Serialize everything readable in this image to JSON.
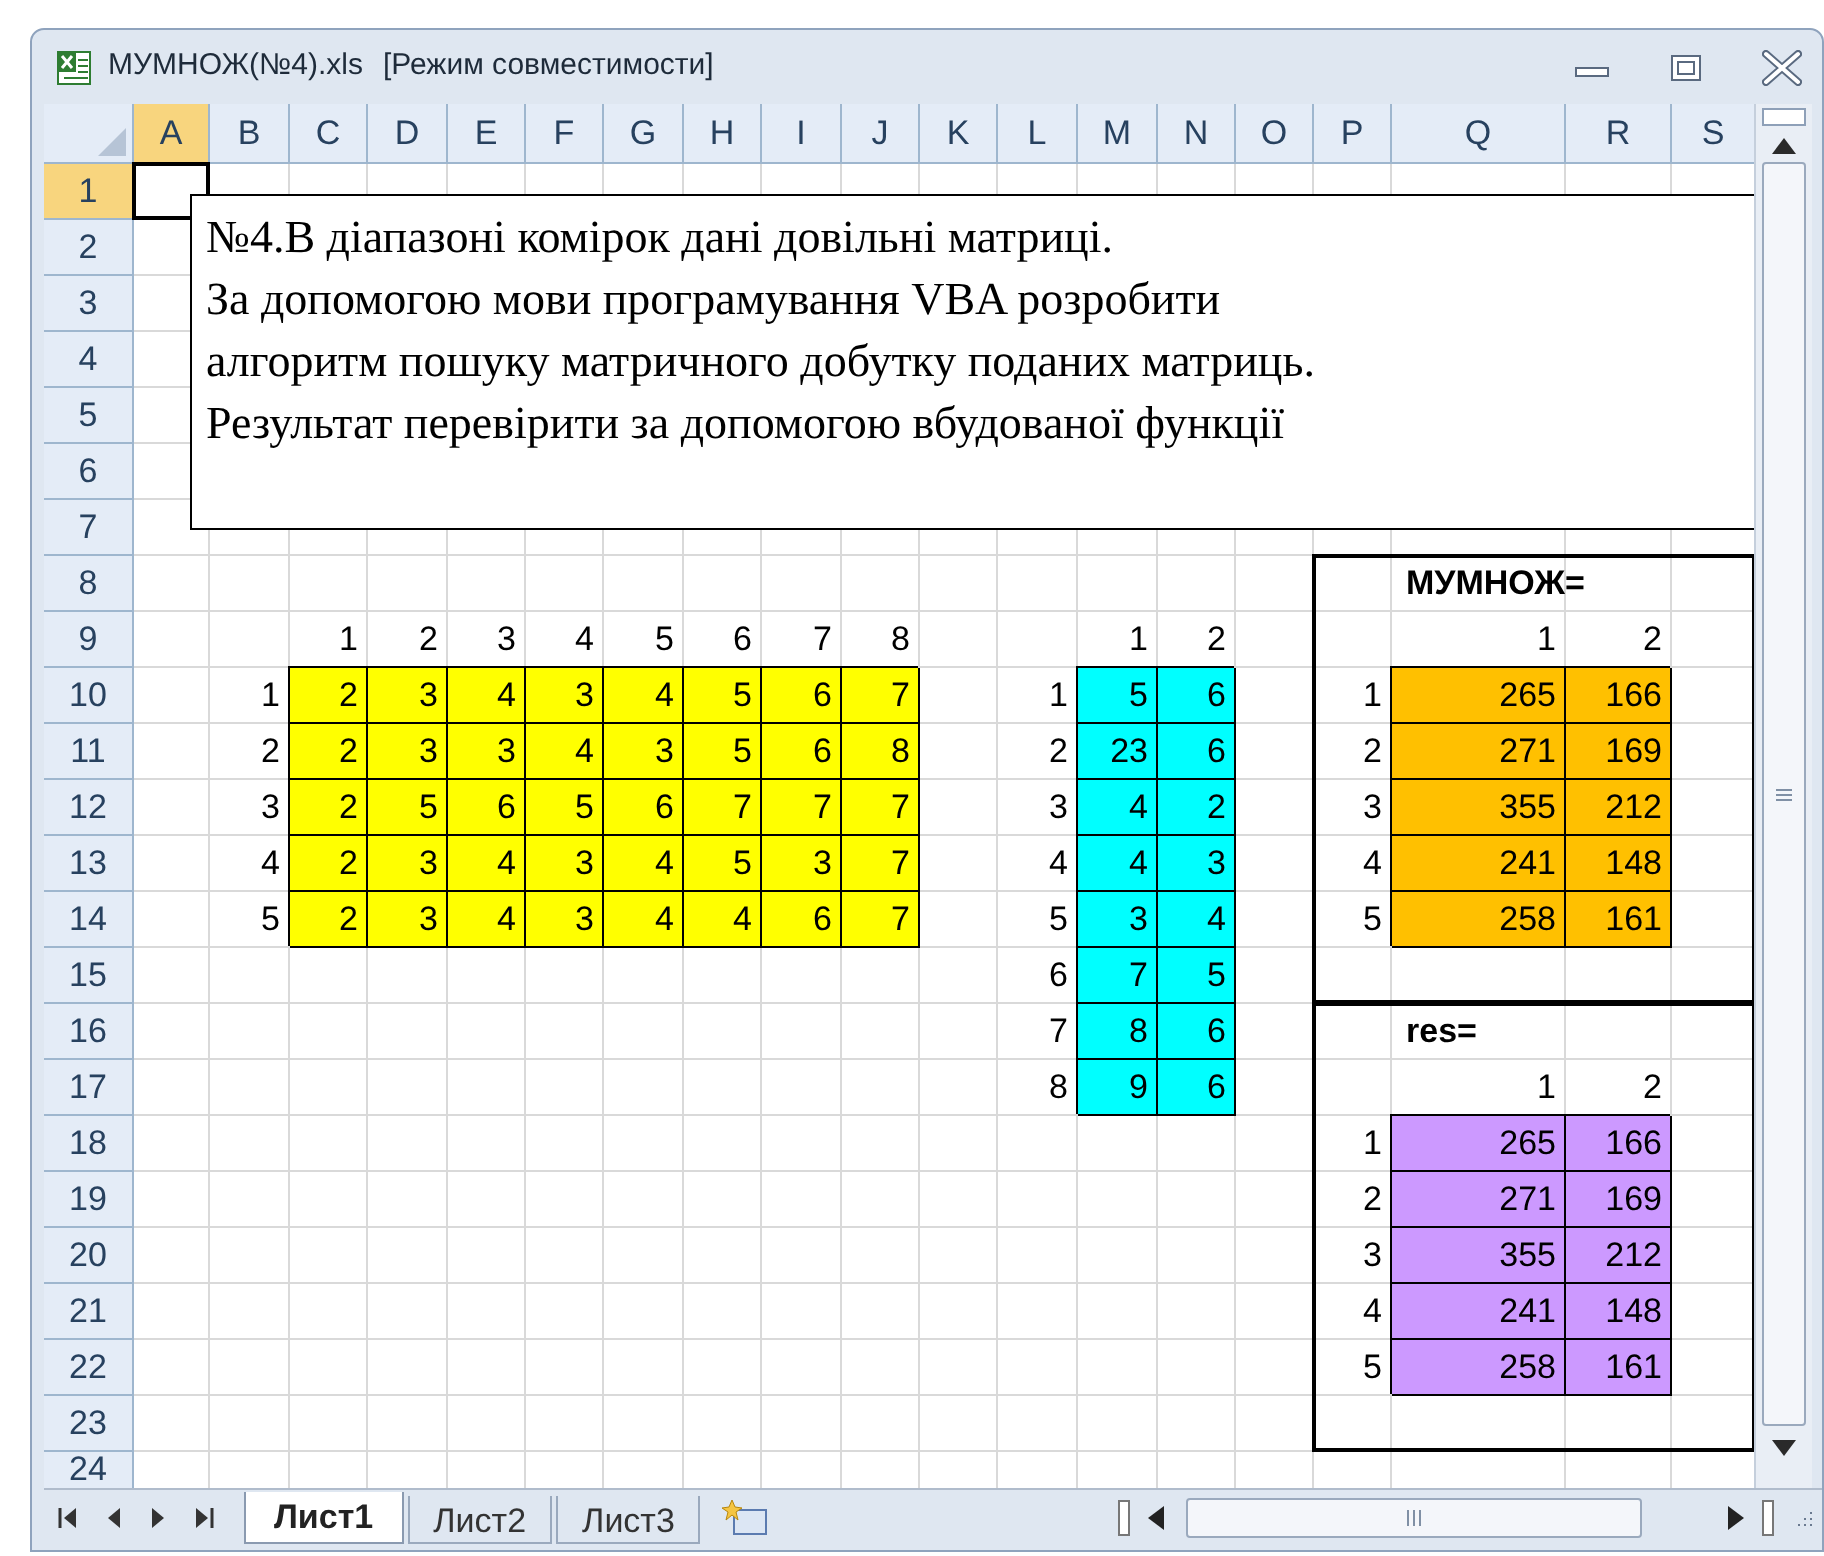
{
  "window": {
    "title": "МУМНОЖ(№4).xls",
    "mode": "[Режим совместимости]"
  },
  "columns": [
    {
      "label": "A",
      "selected": true
    },
    {
      "label": "B",
      "selected": false
    },
    {
      "label": "C",
      "selected": false
    },
    {
      "label": "D",
      "selected": false
    },
    {
      "label": "E",
      "selected": false
    },
    {
      "label": "F",
      "selected": false
    },
    {
      "label": "G",
      "selected": false
    },
    {
      "label": "H",
      "selected": false
    },
    {
      "label": "I",
      "selected": false
    },
    {
      "label": "J",
      "selected": false
    },
    {
      "label": "K",
      "selected": false
    },
    {
      "label": "L",
      "selected": false
    },
    {
      "label": "M",
      "selected": false
    },
    {
      "label": "N",
      "selected": false
    },
    {
      "label": "O",
      "selected": false
    },
    {
      "label": "P",
      "selected": false
    },
    {
      "label": "Q",
      "selected": false
    },
    {
      "label": "R",
      "selected": false
    },
    {
      "label": "S",
      "selected": false
    }
  ],
  "text_box": {
    "lines": [
      "№4.В діапазоні комірок дані довільні матриці.",
      "За допомогою мови програмування VBA розробити",
      "алгоритм пошуку матричного добутку поданих матриць.",
      "Результат перевірити за допомогою вбудованої функції"
    ]
  },
  "rows": [
    {
      "label": "1",
      "selected": true
    },
    {
      "label": "2",
      "selected": false
    },
    {
      "label": "3",
      "selected": false
    },
    {
      "label": "4",
      "selected": false
    },
    {
      "label": "5",
      "selected": false
    },
    {
      "label": "6",
      "selected": false
    },
    {
      "label": "7",
      "selected": false
    },
    {
      "label": "8",
      "selected": false,
      "cells": [
        null,
        null,
        null,
        null,
        null,
        null,
        null,
        null,
        null,
        null,
        null,
        null,
        null,
        null,
        null,
        null,
        {
          "text": "МУМНОЖ=",
          "bold": true
        }
      ]
    },
    {
      "label": "9",
      "selected": false,
      "cells": [
        null,
        null,
        {
          "text": "1"
        },
        {
          "text": "2"
        },
        {
          "text": "3"
        },
        {
          "text": "4"
        },
        {
          "text": "5"
        },
        {
          "text": "6"
        },
        {
          "text": "7"
        },
        {
          "text": "8"
        },
        null,
        null,
        {
          "text": "1"
        },
        {
          "text": "2"
        },
        null,
        null,
        {
          "text": "1"
        },
        {
          "text": "2"
        }
      ]
    },
    {
      "label": "10",
      "selected": false,
      "cells": [
        null,
        {
          "text": "1"
        },
        {
          "text": "2",
          "color": "#ffff00"
        },
        {
          "text": "3",
          "color": "#ffff00"
        },
        {
          "text": "4",
          "color": "#ffff00"
        },
        {
          "text": "3",
          "color": "#ffff00"
        },
        {
          "text": "4",
          "color": "#ffff00"
        },
        {
          "text": "5",
          "color": "#ffff00"
        },
        {
          "text": "6",
          "color": "#ffff00"
        },
        {
          "text": "7",
          "color": "#ffff00"
        },
        null,
        {
          "text": "1"
        },
        {
          "text": "5",
          "color": "#00ffff"
        },
        {
          "text": "6",
          "color": "#00ffff"
        },
        null,
        {
          "text": "1"
        },
        {
          "text": "265",
          "color": "#ffc000"
        },
        {
          "text": "166",
          "color": "#ffc000"
        }
      ]
    },
    {
      "label": "11",
      "selected": false,
      "cells": [
        null,
        {
          "text": "2"
        },
        {
          "text": "2",
          "color": "#ffff00"
        },
        {
          "text": "3",
          "color": "#ffff00"
        },
        {
          "text": "3",
          "color": "#ffff00"
        },
        {
          "text": "4",
          "color": "#ffff00"
        },
        {
          "text": "3",
          "color": "#ffff00"
        },
        {
          "text": "5",
          "color": "#ffff00"
        },
        {
          "text": "6",
          "color": "#ffff00"
        },
        {
          "text": "8",
          "color": "#ffff00"
        },
        null,
        {
          "text": "2"
        },
        {
          "text": "23",
          "color": "#00ffff"
        },
        {
          "text": "6",
          "color": "#00ffff"
        },
        null,
        {
          "text": "2"
        },
        {
          "text": "271",
          "color": "#ffc000"
        },
        {
          "text": "169",
          "color": "#ffc000"
        }
      ]
    },
    {
      "label": "12",
      "selected": false,
      "cells": [
        null,
        {
          "text": "3"
        },
        {
          "text": "2",
          "color": "#ffff00"
        },
        {
          "text": "5",
          "color": "#ffff00"
        },
        {
          "text": "6",
          "color": "#ffff00"
        },
        {
          "text": "5",
          "color": "#ffff00"
        },
        {
          "text": "6",
          "color": "#ffff00"
        },
        {
          "text": "7",
          "color": "#ffff00"
        },
        {
          "text": "7",
          "color": "#ffff00"
        },
        {
          "text": "7",
          "color": "#ffff00"
        },
        null,
        {
          "text": "3"
        },
        {
          "text": "4",
          "color": "#00ffff"
        },
        {
          "text": "2",
          "color": "#00ffff"
        },
        null,
        {
          "text": "3"
        },
        {
          "text": "355",
          "color": "#ffc000"
        },
        {
          "text": "212",
          "color": "#ffc000"
        }
      ]
    },
    {
      "label": "13",
      "selected": false,
      "cells": [
        null,
        {
          "text": "4"
        },
        {
          "text": "2",
          "color": "#ffff00"
        },
        {
          "text": "3",
          "color": "#ffff00"
        },
        {
          "text": "4",
          "color": "#ffff00"
        },
        {
          "text": "3",
          "color": "#ffff00"
        },
        {
          "text": "4",
          "color": "#ffff00"
        },
        {
          "text": "5",
          "color": "#ffff00"
        },
        {
          "text": "3",
          "color": "#ffff00"
        },
        {
          "text": "7",
          "color": "#ffff00"
        },
        null,
        {
          "text": "4"
        },
        {
          "text": "4",
          "color": "#00ffff"
        },
        {
          "text": "3",
          "color": "#00ffff"
        },
        null,
        {
          "text": "4"
        },
        {
          "text": "241",
          "color": "#ffc000"
        },
        {
          "text": "148",
          "color": "#ffc000"
        }
      ]
    },
    {
      "label": "14",
      "selected": false,
      "cells": [
        null,
        {
          "text": "5"
        },
        {
          "text": "2",
          "color": "#ffff00"
        },
        {
          "text": "3",
          "color": "#ffff00"
        },
        {
          "text": "4",
          "color": "#ffff00"
        },
        {
          "text": "3",
          "color": "#ffff00"
        },
        {
          "text": "4",
          "color": "#ffff00"
        },
        {
          "text": "4",
          "color": "#ffff00"
        },
        {
          "text": "6",
          "color": "#ffff00"
        },
        {
          "text": "7",
          "color": "#ffff00"
        },
        null,
        {
          "text": "5"
        },
        {
          "text": "3",
          "color": "#00ffff"
        },
        {
          "text": "4",
          "color": "#00ffff"
        },
        null,
        {
          "text": "5"
        },
        {
          "text": "258",
          "color": "#ffc000"
        },
        {
          "text": "161",
          "color": "#ffc000"
        }
      ]
    },
    {
      "label": "15",
      "selected": false,
      "cells": [
        null,
        null,
        null,
        null,
        null,
        null,
        null,
        null,
        null,
        null,
        null,
        {
          "text": "6"
        },
        {
          "text": "7",
          "color": "#00ffff"
        },
        {
          "text": "5",
          "color": "#00ffff"
        }
      ]
    },
    {
      "label": "16",
      "selected": false,
      "cells": [
        null,
        null,
        null,
        null,
        null,
        null,
        null,
        null,
        null,
        null,
        null,
        {
          "text": "7"
        },
        {
          "text": "8",
          "color": "#00ffff"
        },
        {
          "text": "6",
          "color": "#00ffff"
        },
        null,
        null,
        {
          "text": "res=",
          "bold": true
        }
      ]
    },
    {
      "label": "17",
      "selected": false,
      "cells": [
        null,
        null,
        null,
        null,
        null,
        null,
        null,
        null,
        null,
        null,
        null,
        {
          "text": "8"
        },
        {
          "text": "9",
          "color": "#00ffff"
        },
        {
          "text": "6",
          "color": "#00ffff"
        },
        null,
        null,
        {
          "text": "1"
        },
        {
          "text": "2"
        }
      ]
    },
    {
      "label": "18",
      "selected": false,
      "cells": [
        null,
        null,
        null,
        null,
        null,
        null,
        null,
        null,
        null,
        null,
        null,
        null,
        null,
        null,
        null,
        {
          "text": "1"
        },
        {
          "text": "265",
          "color": "#cc99ff"
        },
        {
          "text": "166",
          "color": "#cc99ff"
        }
      ]
    },
    {
      "label": "19",
      "selected": false,
      "cells": [
        null,
        null,
        null,
        null,
        null,
        null,
        null,
        null,
        null,
        null,
        null,
        null,
        null,
        null,
        null,
        {
          "text": "2"
        },
        {
          "text": "271",
          "color": "#cc99ff"
        },
        {
          "text": "169",
          "color": "#cc99ff"
        }
      ]
    },
    {
      "label": "20",
      "selected": false,
      "cells": [
        null,
        null,
        null,
        null,
        null,
        null,
        null,
        null,
        null,
        null,
        null,
        null,
        null,
        null,
        null,
        {
          "text": "3"
        },
        {
          "text": "355",
          "color": "#cc99ff"
        },
        {
          "text": "212",
          "color": "#cc99ff"
        }
      ]
    },
    {
      "label": "21",
      "selected": false,
      "cells": [
        null,
        null,
        null,
        null,
        null,
        null,
        null,
        null,
        null,
        null,
        null,
        null,
        null,
        null,
        null,
        {
          "text": "4"
        },
        {
          "text": "241",
          "color": "#cc99ff"
        },
        {
          "text": "148",
          "color": "#cc99ff"
        }
      ]
    },
    {
      "label": "22",
      "selected": false,
      "cells": [
        null,
        null,
        null,
        null,
        null,
        null,
        null,
        null,
        null,
        null,
        null,
        null,
        null,
        null,
        null,
        {
          "text": "5"
        },
        {
          "text": "258",
          "color": "#cc99ff"
        },
        {
          "text": "161",
          "color": "#cc99ff"
        }
      ]
    },
    {
      "label": "23",
      "selected": false
    },
    {
      "label": "24",
      "selected": false
    }
  ],
  "sheets": [
    {
      "label": "Лист1",
      "selected": true
    },
    {
      "label": "Лист2",
      "selected": false
    },
    {
      "label": "Лист3",
      "selected": false
    }
  ]
}
